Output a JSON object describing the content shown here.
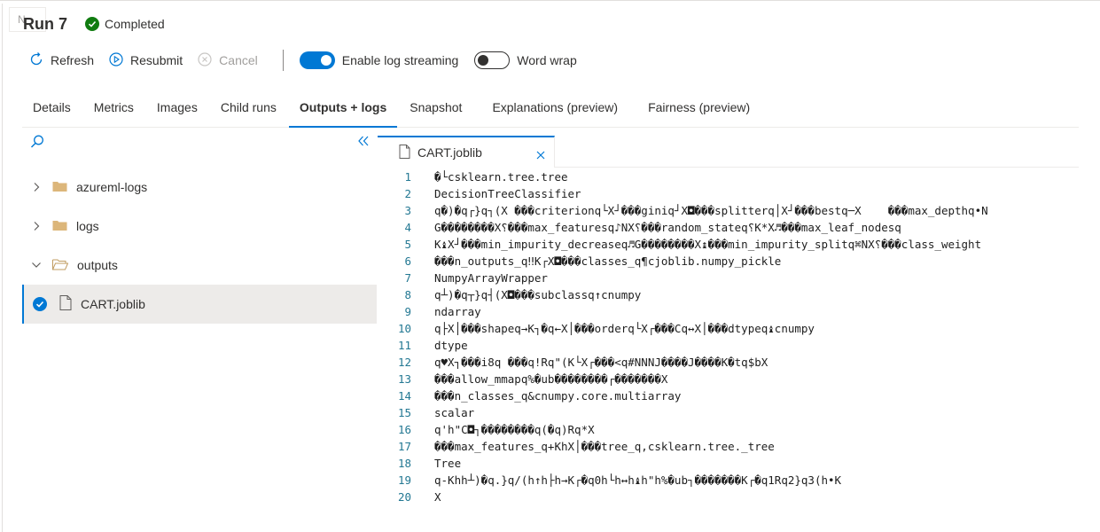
{
  "ghost_label": "N",
  "header": {
    "title": "Run 7",
    "status": "Completed"
  },
  "toolbar": {
    "refresh": "Refresh",
    "resubmit": "Resubmit",
    "cancel": "Cancel",
    "log_streaming": "Enable log streaming",
    "word_wrap": "Word wrap"
  },
  "tabs": [
    "Details",
    "Metrics",
    "Images",
    "Child runs",
    "Outputs + logs",
    "Snapshot",
    "Explanations (preview)",
    "Fairness (preview)"
  ],
  "tree": {
    "items": [
      {
        "name": "azureml-logs"
      },
      {
        "name": "logs"
      },
      {
        "name": "outputs"
      },
      {
        "name": "CART.joblib"
      }
    ]
  },
  "editor": {
    "file_tab": "CART.joblib",
    "lines": [
      "�└csklearn.tree.tree",
      "DecisionTreeClassifier",
      "q�)�q┌}q┐(X ���criterionq└X┘���giniq┘X◘���splitterq│X┘���bestq─X    ���max_depthq•N",
      "G��������X⸮���max_featuresq♪NX⸮���random_stateq⸮K*X♬���max_leaf_nodesq",
      "K♝X┘���min_impurity_decreaseq♬G��������X↨���min_impurity_splitq⌘NX⸮���class_weight",
      "���n_outputs_q‼K┌X◘���classes_q¶cjoblib.numpy_pickle",
      "NumpyArrayWrapper",
      "q┴)�q┬}q┤(X◘���subclassq↑cnumpy",
      "ndarray",
      "q├X│���shapeq→K┐�q←X│���orderq└X┌���Cq↔X│���dtypeq♝cnumpy",
      "dtype",
      "q♥X┐���i8q ���q!Rq\"(K└X┌���<q#NNNJ����J����K�tq$bX",
      "���allow_mmapq%�ub��������┌�������X",
      "���n_classes_q&cnumpy.core.multiarray",
      "scalar",
      "q'h\"C◘┐��������q(�q)Rq*X",
      "���max_features_q+KhX│���tree_q,csklearn.tree._tree",
      "Tree",
      "q-Khh┴)�q.}q/(h↑h├h→K┌�q0h└h↔h♝h\"h%�ub┐�������K┌�q1Rq2}q3(h•K",
      "X"
    ]
  }
}
